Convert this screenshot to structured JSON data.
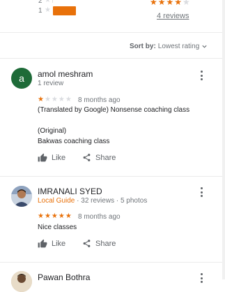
{
  "summary": {
    "rows": [
      {
        "label": "2",
        "fill": 0
      },
      {
        "label": "1",
        "fill": 1
      }
    ],
    "bar_color": "#e8710a",
    "avg_stars": 4,
    "reviews_link": "4 reviews"
  },
  "sort": {
    "label": "Sort by:",
    "value": "Lowest rating"
  },
  "reviews": [
    {
      "avatar_letter": "a",
      "avatar_color": "#1e6b38",
      "name": "amol meshram",
      "meta": "1 review",
      "rating": 1,
      "date": "8 months ago",
      "lines": [
        "(Translated by Google) Nonsense coaching class",
        "",
        "(Original)",
        "Bakwas coaching class"
      ],
      "like": "Like",
      "share": "Share"
    },
    {
      "name": "IMRANALI SYED",
      "badge": "Local Guide",
      "meta": "· 32 reviews · 5 photos",
      "rating": 5,
      "date": "8 months ago",
      "lines": [
        "Nice classes"
      ],
      "like": "Like",
      "share": "Share"
    },
    {
      "name": "Pawan Bothra"
    }
  ],
  "icons": {
    "star": "star-icon",
    "more": "more-vert-icon",
    "like": "thumb-up-icon",
    "share": "share-icon",
    "chevron": "chevron-down-icon"
  }
}
